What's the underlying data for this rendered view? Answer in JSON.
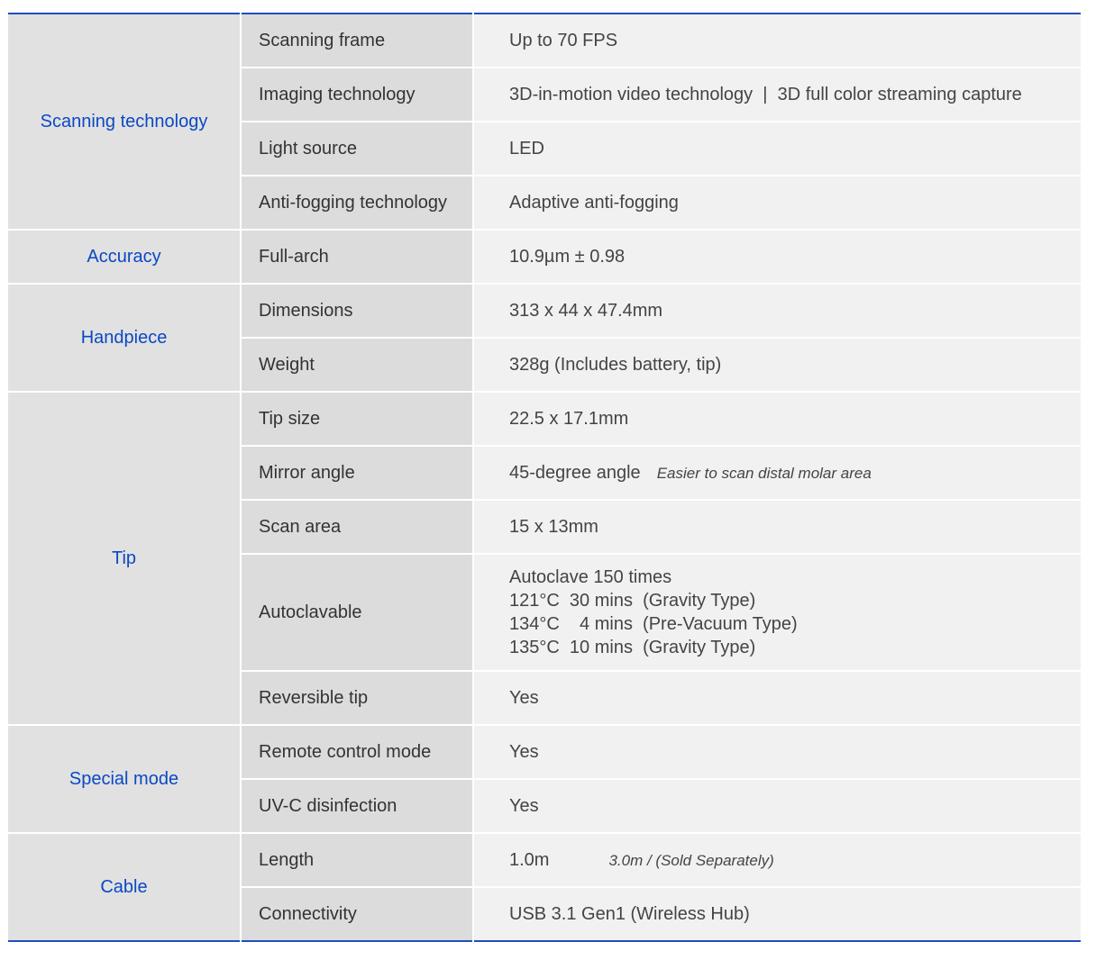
{
  "categories": {
    "scanning": "Scanning technology",
    "accuracy": "Accuracy",
    "handpiece": "Handpiece",
    "tip": "Tip",
    "special": "Special mode",
    "cable": "Cable"
  },
  "rows": {
    "scanning_frame": {
      "label": "Scanning frame",
      "value": "Up to 70 FPS"
    },
    "imaging": {
      "label": "Imaging technology",
      "value": "3D-in-motion video technology  |  3D full color streaming capture"
    },
    "light": {
      "label": "Light source",
      "value": "LED"
    },
    "antifog": {
      "label": "Anti-fogging technology",
      "value": "Adaptive anti-fogging"
    },
    "fullarch": {
      "label": "Full-arch",
      "value": "10.9µm ± 0.98"
    },
    "dimensions": {
      "label": "Dimensions",
      "value": "313 x 44 x 47.4mm"
    },
    "weight": {
      "label": "Weight",
      "value": "328g (Includes battery, tip)"
    },
    "tipsize": {
      "label": "Tip size",
      "value": "22.5 x 17.1mm"
    },
    "mirror": {
      "label": "Mirror angle",
      "value": "45-degree angle",
      "note": "Easier to scan distal molar area"
    },
    "scanarea": {
      "label": "Scan area",
      "value": "15 x 13mm"
    },
    "autoclave": {
      "label": "Autoclavable",
      "lines": [
        "Autoclave 150 times",
        "121°C  30 mins  (Gravity Type)",
        "134°C    4 mins  (Pre-Vacuum Type)",
        "135°C  10 mins  (Gravity Type)"
      ]
    },
    "reversible": {
      "label": "Reversible tip",
      "value": "Yes"
    },
    "remote": {
      "label": "Remote control mode",
      "value": "Yes"
    },
    "uvc": {
      "label": "UV-C disinfection",
      "value": "Yes"
    },
    "length": {
      "label": "Length",
      "value": "1.0m",
      "note": "3.0m / (Sold Separately)"
    },
    "connectivity": {
      "label": "Connectivity",
      "value": "USB 3.1 Gen1 (Wireless Hub)"
    }
  }
}
